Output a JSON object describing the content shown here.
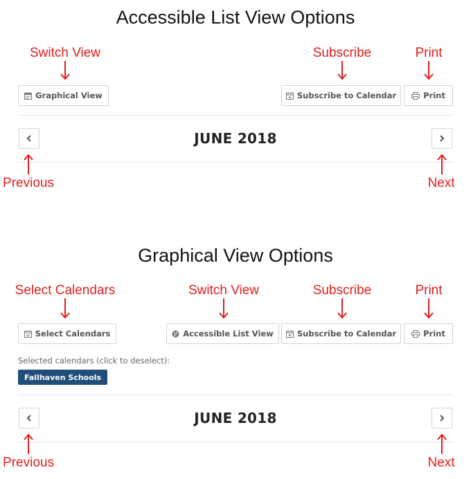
{
  "top": {
    "title": "Accessible List View Options",
    "annotations": {
      "switch_view": "Switch View",
      "subscribe": "Subscribe",
      "print": "Print",
      "previous": "Previous",
      "next": "Next"
    },
    "buttons": {
      "graphical_view": "Graphical View",
      "subscribe": "Subscribe to Calendar",
      "print": "Print"
    },
    "month": "JUNE 2018"
  },
  "bottom": {
    "title": "Graphical View Options",
    "annotations": {
      "select_calendars": "Select Calendars",
      "switch_view": "Switch View",
      "subscribe": "Subscribe",
      "print": "Print",
      "previous": "Previous",
      "next": "Next"
    },
    "buttons": {
      "select_calendars": "Select Calendars",
      "accessible_list_view": "Accessible List View",
      "subscribe": "Subscribe to Calendar",
      "print": "Print"
    },
    "selected_label": "Selected calendars (click to deselect):",
    "selected_calendar": "Fallhaven Schools",
    "month": "JUNE 2018"
  },
  "colors": {
    "annotation": "#e11d1d",
    "badge": "#1f4e79",
    "border": "#cfd4d9"
  },
  "icons": [
    "calendar-icon",
    "calendar-plus-icon",
    "printer-icon",
    "globe-icon",
    "chevron-left-icon",
    "chevron-right-icon",
    "arrow-down-icon",
    "arrow-up-icon"
  ]
}
